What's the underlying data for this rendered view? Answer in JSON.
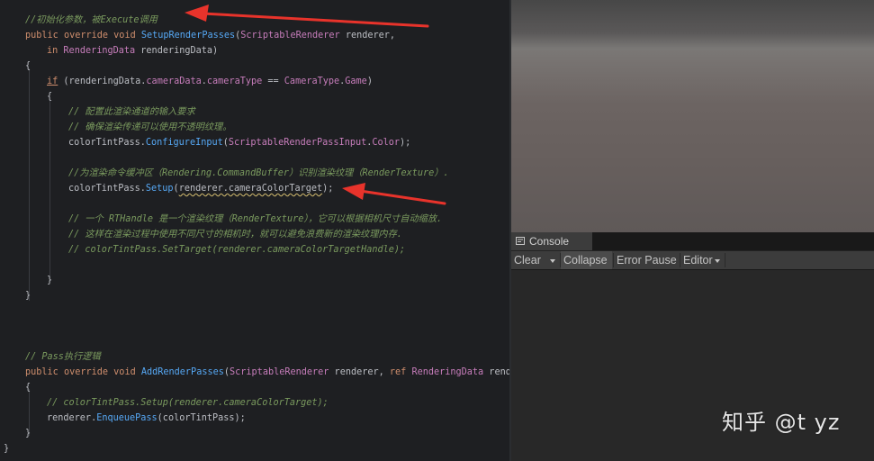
{
  "code": {
    "comment_init": "//初始化参数，被Execute调用",
    "l2": {
      "kw1": "public",
      "kw2": "override",
      "kw3": "void",
      "fn": "SetupRenderPasses",
      "p1": "(",
      "ty": "ScriptableRenderer",
      "p2": " renderer,"
    },
    "l3": {
      "kw": "in",
      "ty": "RenderingData",
      "p": " renderingData)"
    },
    "brace_open": "{",
    "brace_close": "}",
    "l5": {
      "kw": "if",
      "p1": " (renderingData.",
      "pr1": "cameraData",
      "p2": ".",
      "pr2": "cameraType",
      "p3": " == ",
      "ty": "CameraType",
      "p4": ".",
      "pr3": "Game",
      "p5": ")"
    },
    "c7": "// 配置此渲染通道的输入要求",
    "c8": "// 确保渲染传递可以使用不透明纹理。",
    "l9": {
      "p1": "colorTintPass.",
      "fn": "ConfigureInput",
      "p2": "(",
      "ty": "ScriptableRenderPassInput",
      "p3": ".",
      "pr": "Color",
      "p4": ");"
    },
    "c11": "//为渲染命令缓冲区（Rendering.CommandBuffer）识别渲染纹理（RenderTexture）.",
    "l12": {
      "p1": "colorTintPass.",
      "fn": "Setup",
      "p2": "(",
      "w": "renderer.cameraColorTarget",
      "p3": ");"
    },
    "c14": "// 一个 RTHandle 是一个渲染纹理（RenderTexture），它可以根据相机尺寸自动缩放.",
    "c15": "// 这样在渲染过程中使用不同尺寸的相机时，就可以避免浪费新的渲染纹理内存.",
    "c16": "// colorTintPass.SetTarget(renderer.cameraColorTargetHandle);",
    "comment_pass": "// Pass执行逻辑",
    "l24": {
      "kw1": "public",
      "kw2": "override",
      "kw3": "void",
      "fn": "AddRenderPasses",
      "p1": "(",
      "ty": "ScriptableRenderer",
      "p2": " renderer, ",
      "kw4": "ref",
      "ty2": "RenderingData",
      "p3": " render"
    },
    "c26": "// colorTintPass.Setup(renderer.cameraColorTarget);",
    "l27": {
      "p1": "renderer.",
      "fn": "EnqueuePass",
      "p2": "(colorTintPass);"
    }
  },
  "console": {
    "tab_label": "Console",
    "toolbar": {
      "clear": "Clear",
      "collapse": "Collapse",
      "error_pause": "Error Pause",
      "editor": "Editor"
    }
  },
  "watermark": "知乎 @t yz",
  "icons": {
    "console_tab": "console-icon",
    "dropdowns": "caret-down-icon",
    "annotations": "red-arrow-icon"
  },
  "colors": {
    "keyword": "#cf8e6d",
    "type": "#c77dbb",
    "function": "#56a8f5",
    "comment": "#7a9a5e",
    "text": "#bcbec4",
    "arrow": "#e8332b"
  }
}
